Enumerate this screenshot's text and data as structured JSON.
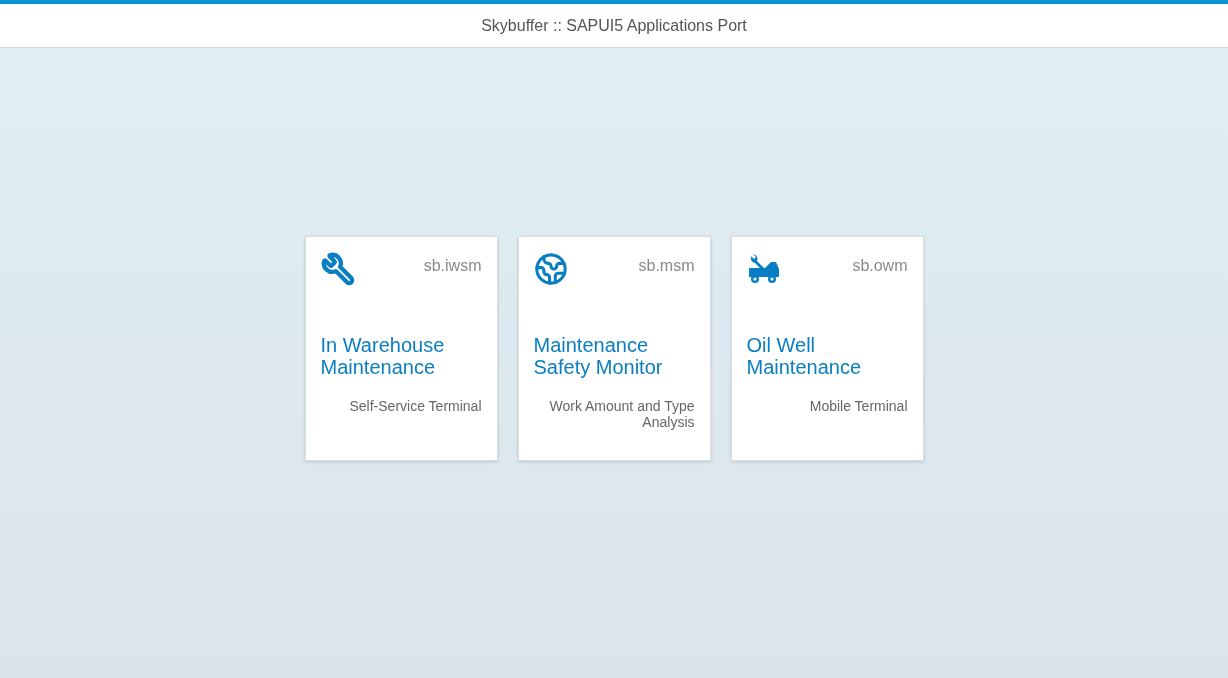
{
  "header": {
    "title": "Skybuffer :: SAPUI5 Applications Port"
  },
  "tiles": [
    {
      "kind": "wrench",
      "code": "sb.iwsm",
      "title": "In Warehouse Maintenance",
      "subtitle": "Self-Service Terminal"
    },
    {
      "kind": "globe",
      "code": "sb.msm",
      "title": "Maintenance Safety Monitor",
      "subtitle": "Work Amount and Type Analysis"
    },
    {
      "kind": "truck",
      "code": "sb.owm",
      "title": "Oil Well Maintenance",
      "subtitle": "Mobile Terminal"
    }
  ]
}
